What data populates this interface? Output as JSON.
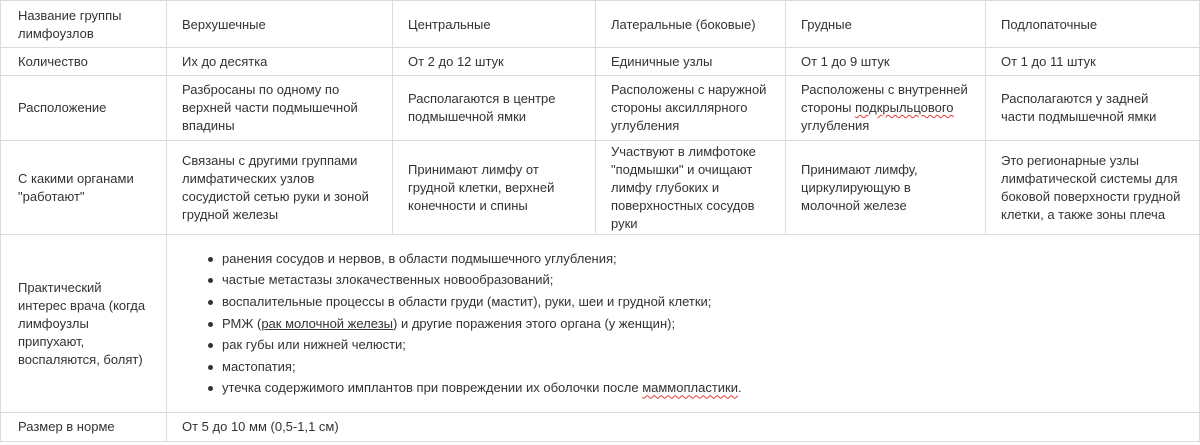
{
  "table": {
    "header": {
      "group_name": "Название группы лимфоузлов",
      "columns": [
        "Верхушечные",
        "Центральные",
        "Латеральные (боковые)",
        "Грудные",
        "Подлопаточные"
      ]
    },
    "count_row": {
      "label": "Количество",
      "values": [
        "Их до десятка",
        "От 2 до 12 штук",
        "Единичные узлы",
        "От 1 до 9 штук",
        "От 1 до 11 штук"
      ]
    },
    "location_row": {
      "label": "Расположение",
      "values": [
        "Разбросаны по одному по верхней части подмышечной впадины",
        "Располагаются в центре подмышечной ямки",
        "Расположены с наружной стороны аксиллярного углубления",
        {
          "before": "Расположены с внутренней стороны ",
          "marked": "подкрыльцового",
          "after": " углубления"
        },
        "Располагаются у задней части подмышечной ямки"
      ]
    },
    "organs_row": {
      "label": "С какими органами \"работают\"",
      "values": [
        "Связаны с другими группами лимфатических узлов сосудистой сетью руки и зоной грудной железы",
        "Принимают лимфу от грудной клетки, верхней конечности и спины",
        "Участвуют в лимфотоке \"подмышки\" и очищают лимфу глубоких и поверхностных сосудов руки",
        "Принимают лимфу, циркулирующую в молочной железе",
        "Это регионарные узлы лимфатической системы для боковой поверхности грудной клетки, а также зоны плеча"
      ]
    },
    "interest_row": {
      "label": "Практический интерес врача (когда лимфоузлы припухают, воспаляются, болят)",
      "items": [
        {
          "text": "ранения сосудов и нервов, в области подмышечного углубления;"
        },
        {
          "text": "частые метастазы злокачественных новообразований;"
        },
        {
          "text": "воспалительные процессы в области груди (мастит), руки, шеи и грудной клетки;"
        },
        {
          "before": "РМЖ (",
          "link": "рак молочной железы",
          "after": ") и другие поражения этого органа (у женщин);"
        },
        {
          "text": "рак губы или нижней челюсти;"
        },
        {
          "text": "мастопатия;"
        },
        {
          "before": "утечка содержимого имплантов при повреждении их оболочки после ",
          "marked": "маммопластики",
          "after": "."
        }
      ]
    },
    "size_row": {
      "label": "Размер в норме",
      "value": "От 5 до 10 мм (0,5-1,1 см)"
    }
  }
}
